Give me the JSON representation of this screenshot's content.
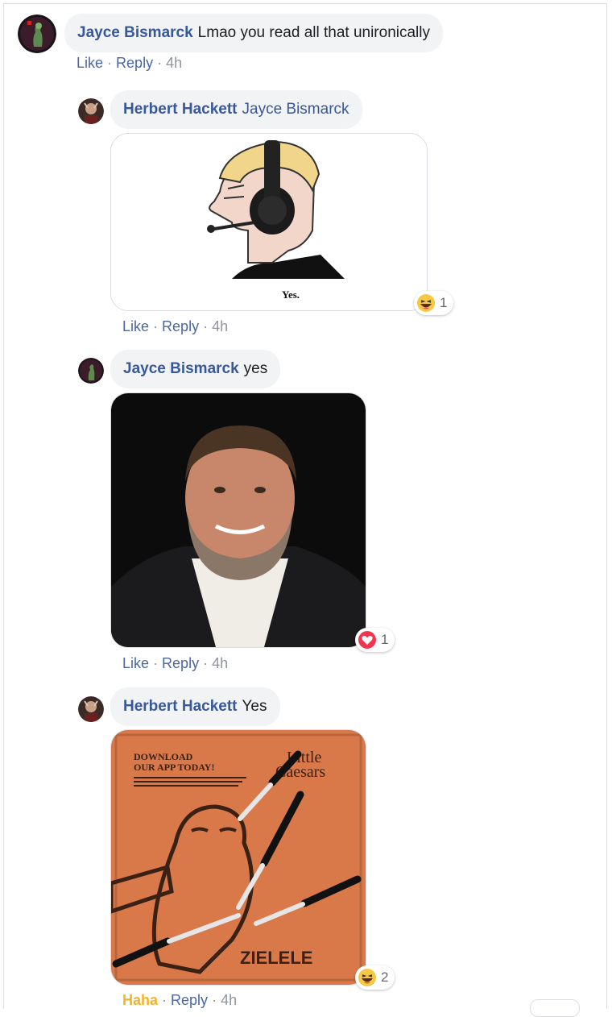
{
  "comments": [
    {
      "author": "Jayce Bismarck",
      "text": "Lmao you read all that unironically",
      "like_label": "Like",
      "reply_label": "Reply",
      "time": "4h"
    }
  ],
  "replies": [
    {
      "author": "Herbert Hackett",
      "tag": "Jayce Bismarck",
      "attachment": "chad-headset-meme",
      "meme_caption": "Yes.",
      "reaction_icon": "haha-icon",
      "reaction_count": "1",
      "like_label": "Like",
      "reply_label": "Reply",
      "time": "4h"
    },
    {
      "author": "Jayce Bismarck",
      "text": "yes",
      "attachment": "bearded-man-photo",
      "reaction_icon": "love-icon",
      "reaction_count": "1",
      "like_label": "Like",
      "reply_label": "Reply",
      "time": "4h"
    },
    {
      "author": "Herbert Hackett",
      "text": "Yes",
      "attachment": "pizza-box-knives-photo",
      "box_headline_1": "DOWNLOAD",
      "box_headline_2": "OUR APP TODAY!",
      "box_brand_1": "Little",
      "box_brand_2": "Caesars",
      "reaction_icon": "haha-icon",
      "reaction_count": "2",
      "like_label": "Haha",
      "reply_label": "Reply",
      "time": "4h"
    }
  ],
  "colors": {
    "author_link": "#385898",
    "action_link": "#4b67a1",
    "haha_active": "#f7b125",
    "bubble_bg": "#f2f3f5"
  }
}
